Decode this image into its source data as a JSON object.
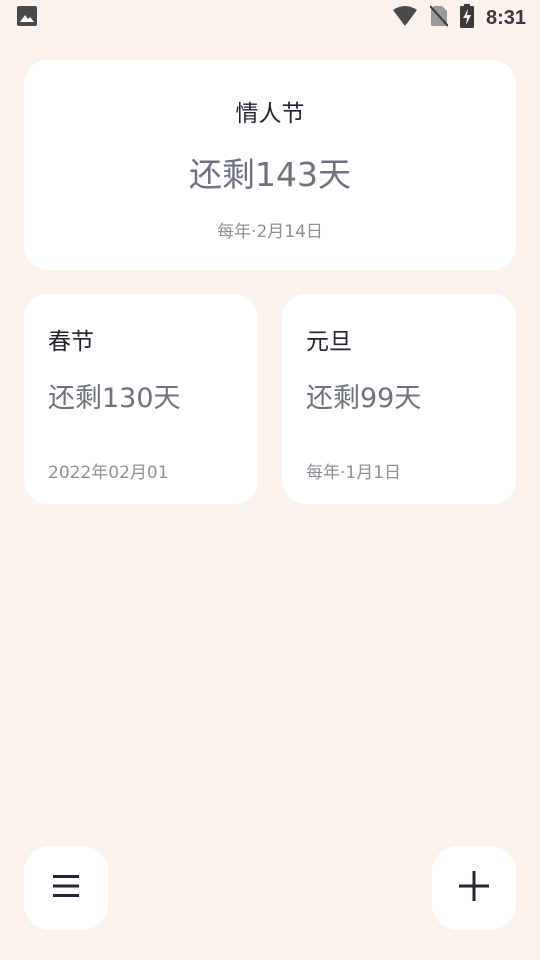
{
  "status_bar": {
    "time": "8:31",
    "icons": [
      "image-icon",
      "wifi-icon",
      "no-sim-icon",
      "battery-charging-icon"
    ]
  },
  "events": {
    "featured": {
      "title": "情人节",
      "remaining": "还剩143天",
      "date": "每年·2月14日"
    },
    "cards": [
      {
        "title": "春节",
        "remaining": "还剩130天",
        "date": "2022年02月01"
      },
      {
        "title": "元旦",
        "remaining": "还剩99天",
        "date": "每年·1月1日"
      }
    ]
  },
  "actions": {
    "menu_icon": "menu-icon",
    "add_icon": "plus-icon"
  },
  "colors": {
    "background": "#FBF3EB",
    "card": "#FFFFFF",
    "title_text": "#1F2233",
    "remaining_text": "#6E7280",
    "date_text": "#8E9098"
  }
}
